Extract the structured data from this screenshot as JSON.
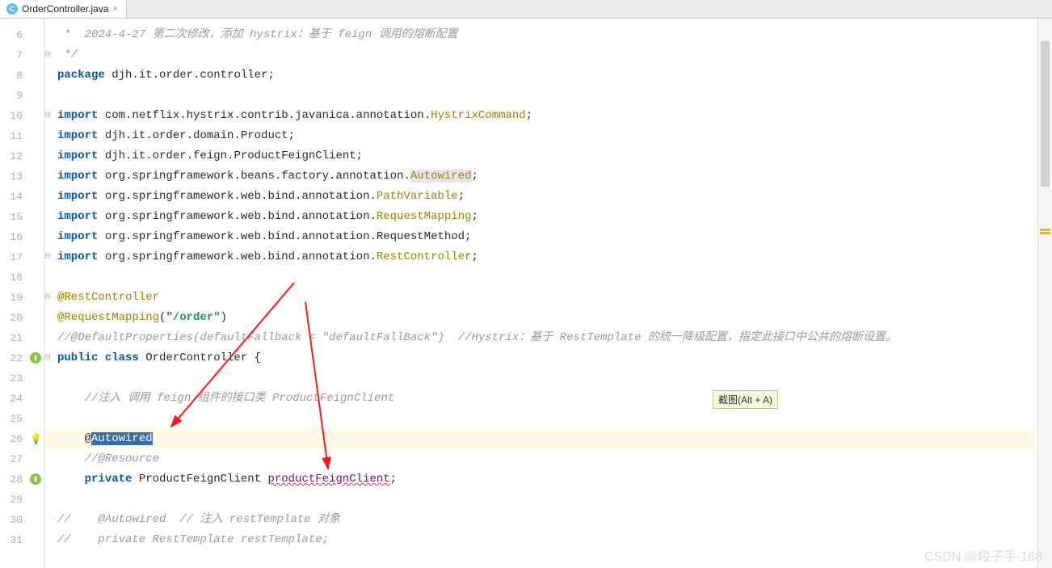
{
  "tab": {
    "icon_letter": "C",
    "filename": "OrderController.java",
    "close": "×"
  },
  "tooltip": "截图(Alt + A)",
  "watermark": "CSDN @段子手-168",
  "gutter_start": 6,
  "lines": [
    {
      "n": 6,
      "fold": "",
      "tokens": [
        [
          " *  2024-4-27 第二次修改，添加 hystrix：基于 feign 调用的熔断配置",
          "cmt"
        ]
      ]
    },
    {
      "n": 7,
      "fold": "⊟",
      "tokens": [
        [
          " */",
          "cmt"
        ]
      ]
    },
    {
      "n": 8,
      "fold": "",
      "tokens": [
        [
          "package ",
          "kw"
        ],
        [
          "djh.it.order.controller;",
          "path"
        ]
      ]
    },
    {
      "n": 9,
      "fold": "",
      "tokens": [
        [
          "",
          ""
        ]
      ]
    },
    {
      "n": 10,
      "fold": "⊟",
      "tokens": [
        [
          "import ",
          "kw"
        ],
        [
          "com.netflix.hystrix.contrib.javanica.annotation.",
          "path"
        ],
        [
          "HystrixCommand",
          "cls"
        ],
        [
          ";",
          "path"
        ]
      ]
    },
    {
      "n": 11,
      "fold": "",
      "tokens": [
        [
          "import ",
          "kw"
        ],
        [
          "djh.it.order.domain.Product;",
          "path"
        ]
      ]
    },
    {
      "n": 12,
      "fold": "",
      "tokens": [
        [
          "import ",
          "kw"
        ],
        [
          "djh.it.order.feign.ProductFeignClient;",
          "path"
        ]
      ]
    },
    {
      "n": 13,
      "fold": "",
      "tokens": [
        [
          "import ",
          "kw"
        ],
        [
          "org.springframework.beans.factory.annotation.",
          "path"
        ],
        [
          "Autowired",
          "cls hl-box"
        ],
        [
          ";",
          "path"
        ]
      ]
    },
    {
      "n": 14,
      "fold": "",
      "tokens": [
        [
          "import ",
          "kw"
        ],
        [
          "org.springframework.web.bind.annotation.",
          "path"
        ],
        [
          "PathVariable",
          "cls"
        ],
        [
          ";",
          "path"
        ]
      ]
    },
    {
      "n": 15,
      "fold": "",
      "tokens": [
        [
          "import ",
          "kw"
        ],
        [
          "org.springframework.web.bind.annotation.",
          "path"
        ],
        [
          "RequestMapping",
          "cls"
        ],
        [
          ";",
          "path"
        ]
      ]
    },
    {
      "n": 16,
      "fold": "",
      "tokens": [
        [
          "import ",
          "kw"
        ],
        [
          "org.springframework.web.bind.annotation.RequestMethod;",
          "path"
        ]
      ]
    },
    {
      "n": 17,
      "fold": "⊟",
      "tokens": [
        [
          "import ",
          "kw"
        ],
        [
          "org.springframework.web.bind.annotation.",
          "path"
        ],
        [
          "RestController",
          "cls"
        ],
        [
          ";",
          "path"
        ]
      ]
    },
    {
      "n": 18,
      "fold": "",
      "tokens": [
        [
          "",
          ""
        ]
      ]
    },
    {
      "n": 19,
      "fold": "⊟",
      "tokens": [
        [
          "@RestController",
          "ann"
        ]
      ]
    },
    {
      "n": 20,
      "fold": "",
      "tokens": [
        [
          "@RequestMapping",
          "ann"
        ],
        [
          "(",
          "path"
        ],
        [
          "\"/order\"",
          "str"
        ],
        [
          ")",
          "path"
        ]
      ]
    },
    {
      "n": 21,
      "fold": "",
      "tokens": [
        [
          "//@DefaultProperties(defaultFallback = \"defaultFallBack\")  //Hystrix：基于 RestTemplate 的统一降级配置，指定此接口中公共的熔断设置。",
          "cmt"
        ]
      ]
    },
    {
      "n": 22,
      "fold": "⊟",
      "icon": "spring",
      "tokens": [
        [
          "public class ",
          "kw"
        ],
        [
          "OrderController {",
          "path"
        ]
      ]
    },
    {
      "n": 23,
      "fold": "",
      "tokens": [
        [
          "",
          ""
        ]
      ]
    },
    {
      "n": 24,
      "fold": "",
      "tokens": [
        [
          "    //注入 调用 feign 组件的接口类 ProductFeignClient",
          "cmt"
        ]
      ]
    },
    {
      "n": 25,
      "fold": "",
      "tokens": [
        [
          "",
          ""
        ]
      ]
    },
    {
      "n": 26,
      "fold": "",
      "hl": true,
      "bulb": true,
      "tokens": [
        [
          "    @",
          "path"
        ],
        [
          "Autowired",
          "sel"
        ]
      ]
    },
    {
      "n": 27,
      "fold": "",
      "tokens": [
        [
          "    //@Resource",
          "cmt"
        ]
      ]
    },
    {
      "n": 28,
      "fold": "",
      "icon": "spring",
      "tokens": [
        [
          "    ",
          "path"
        ],
        [
          "private ",
          "kw"
        ],
        [
          "ProductFeignClient ",
          "path"
        ],
        [
          "productFeignClient",
          "id underline-wavy"
        ],
        [
          ";",
          "path"
        ]
      ]
    },
    {
      "n": 29,
      "fold": "",
      "tokens": [
        [
          "",
          ""
        ]
      ]
    },
    {
      "n": 30,
      "fold": "",
      "tokens": [
        [
          "//    @Autowired  // 注入 restTemplate 对象",
          "cmt"
        ]
      ]
    },
    {
      "n": 31,
      "fold": "",
      "tokens": [
        [
          "//    private RestTemplate restTemplate;",
          "cmt"
        ]
      ]
    }
  ]
}
